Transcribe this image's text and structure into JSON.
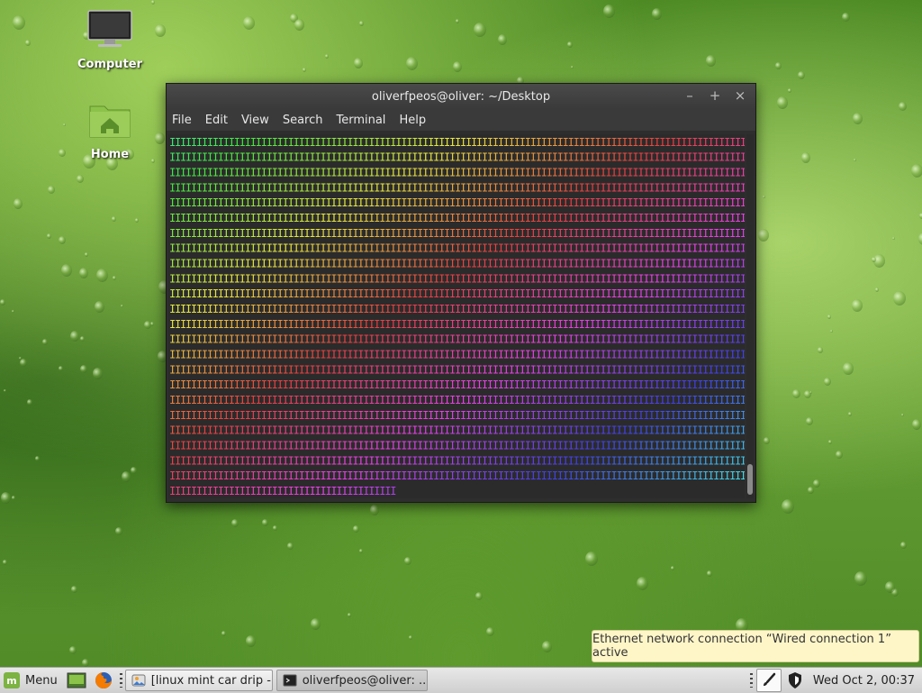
{
  "desktop": {
    "icons": [
      {
        "label": "Computer",
        "icon": "computer-icon"
      },
      {
        "label": "Home",
        "icon": "home-folder-icon"
      }
    ]
  },
  "terminal": {
    "title": "oliverfpeos@oliver: ~/Desktop",
    "menu": [
      "File",
      "Edit",
      "View",
      "Search",
      "Terminal",
      "Help"
    ],
    "controls": [
      "minimize",
      "maximize",
      "close"
    ],
    "output_char": "I",
    "output_full_rows": 23,
    "output_last_row_chars": 42,
    "output_cols": 107,
    "palette_note_colors": [
      "#3ec45c",
      "#c8d83a",
      "#f2a93b",
      "#f0605a",
      "#d43a8a",
      "#8a3ad0",
      "#4a6cf0"
    ]
  },
  "notification": {
    "text": "Ethernet network connection “Wired connection 1” active"
  },
  "panel": {
    "menu_label": "Menu",
    "launchers": [
      "show-desktop-icon",
      "firefox-icon"
    ],
    "tasks": [
      {
        "label": "[linux mint car drip -...",
        "icon": "image-viewer-icon",
        "active": false
      },
      {
        "label": "oliverfpeos@oliver: ...",
        "icon": "terminal-icon",
        "active": true
      }
    ],
    "tray": [
      "brush-icon",
      "shield-icon"
    ],
    "clock": "Wed Oct  2, 00:37"
  },
  "colors": {
    "terminal_bg": "#2b2b2b",
    "titlebar": "#3c3c3c",
    "notification_bg": "#fff6c8",
    "panel_bg": "#dcdcdc",
    "mint_green": "#7cb342"
  }
}
